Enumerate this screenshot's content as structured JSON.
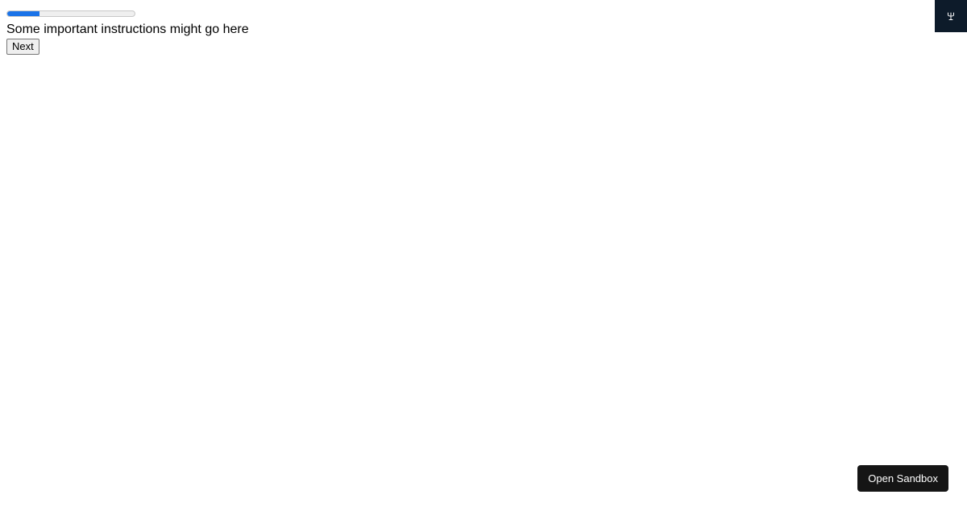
{
  "progress": {
    "value": 0.25,
    "fill_color": "#1a73e8",
    "track_color": "#efefef"
  },
  "main": {
    "instructions": "Some important instructions might go here",
    "next_label": "Next"
  },
  "corner_badge": {
    "icon": "trident-icon",
    "background": "#0d1b2a"
  },
  "sandbox": {
    "label": "Open Sandbox",
    "background": "#151515"
  }
}
